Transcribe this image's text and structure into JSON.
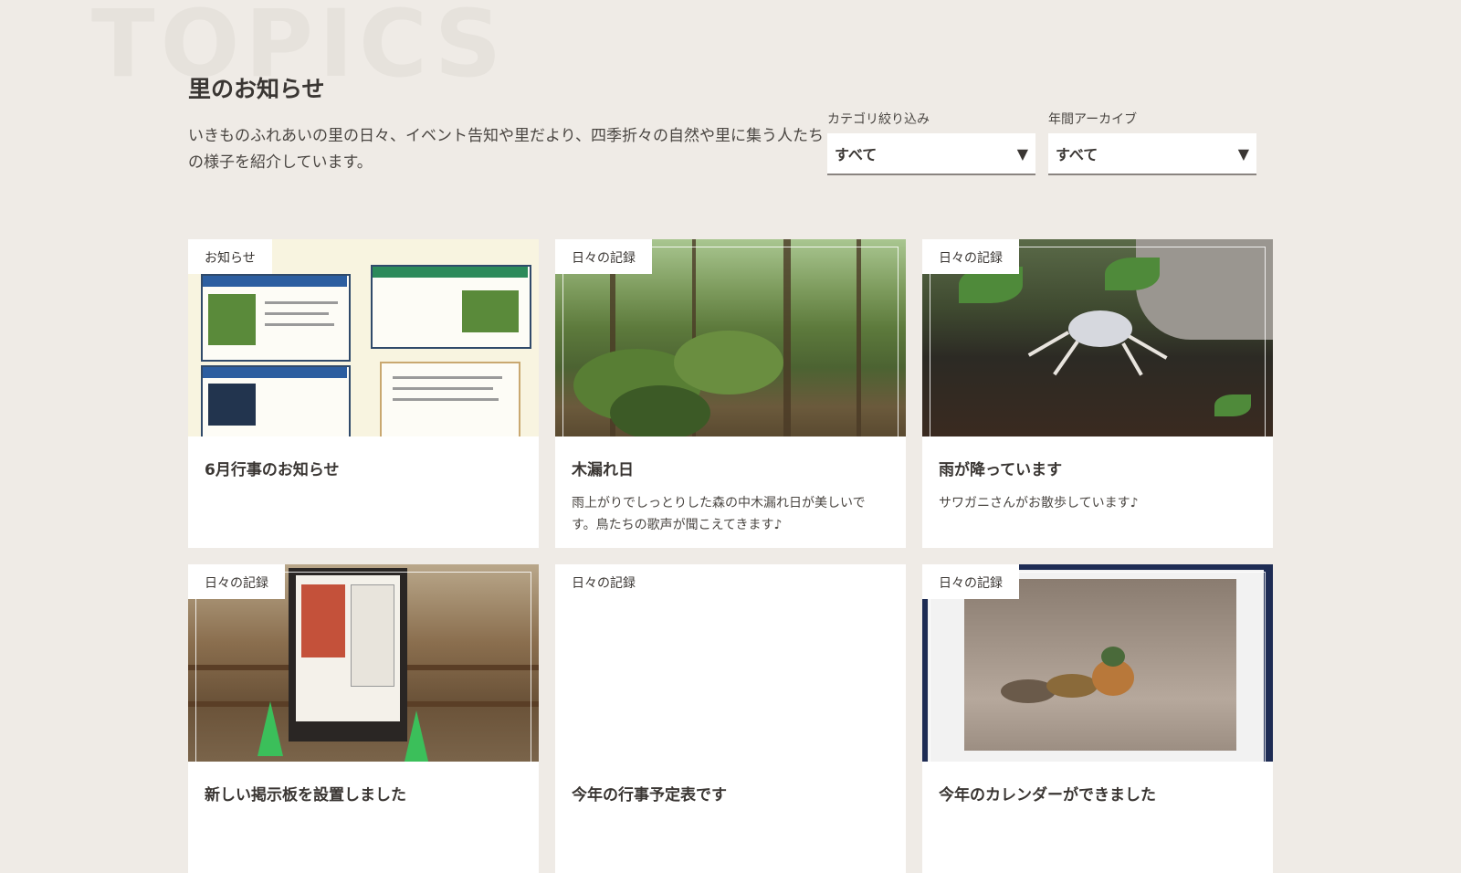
{
  "header": {
    "bg_word": "TOPICS",
    "title": "里のお知らせ",
    "description": "いきものふれあいの里の日々、イベント告知や里だより、四季折々の自然や里に集う人たちの様子を紹介しています。"
  },
  "filters": {
    "category": {
      "label": "カテゴリ絞り込み",
      "value": "すべて",
      "arrow": "▼"
    },
    "archive": {
      "label": "年間アーカイブ",
      "value": "すべて",
      "arrow": "▼"
    }
  },
  "cards": [
    {
      "category": "お知らせ",
      "title": "6月行事のお知らせ",
      "text": "",
      "image": "event-flyer"
    },
    {
      "category": "日々の記録",
      "title": "木漏れ日",
      "text": "雨上がりでしっとりした森の中木漏れ日が美しいです。鳥たちの歌声が聞こえてきます♪",
      "image": "forest-photo"
    },
    {
      "category": "日々の記録",
      "title": "雨が降っています",
      "text": "サワガニさんがお散歩しています♪",
      "image": "crab-photo"
    },
    {
      "category": "日々の記録",
      "title": "新しい掲示板を設置しました",
      "text": "",
      "image": "notice-board-photo"
    },
    {
      "category": "日々の記録",
      "title": "今年の行事予定表です",
      "text": "",
      "image": ""
    },
    {
      "category": "日々の記録",
      "title": "今年のカレンダーができました",
      "text": "",
      "image": "calendar-photo"
    }
  ],
  "colors": {
    "background": "#efebe6",
    "card": "#ffffff",
    "text": "#3a3633"
  }
}
